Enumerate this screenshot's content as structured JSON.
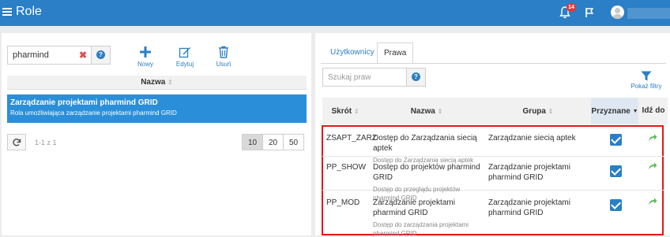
{
  "header": {
    "title": "Role",
    "notification_count": "14"
  },
  "left": {
    "search_value": "pharmind",
    "toolbar": {
      "new_label": "Nowy",
      "edit_label": "Edytuj",
      "delete_label": "Usuń"
    },
    "column_header": "Nazwa",
    "selected_role": {
      "name": "Zarządzanie projektami pharmind GRID",
      "description": "Rola umożliwiająca zarządzanie projektami pharmind GRID"
    },
    "page_info": "1-1 z 1",
    "page_sizes": [
      "10",
      "20",
      "50"
    ],
    "active_page_size": "10"
  },
  "right": {
    "tabs": {
      "users": "Użytkownicy",
      "rights": "Prawa"
    },
    "search_placeholder": "Szukaj praw",
    "show_filters": "Pokaż filtry",
    "columns": {
      "code": "Skrót",
      "name": "Nazwa",
      "group": "Grupa",
      "granted": "Przyznane",
      "goto": "Idź do"
    },
    "rows": [
      {
        "code": "ZSAPT_ZARZ",
        "name": "Dostęp do Zarządzania siecią aptek",
        "description": "Dostęp do Zarządzania siecią aptek",
        "group": "Zarządzanie siecią aptek",
        "granted": true
      },
      {
        "code": "PP_SHOW",
        "name": "Dostęp do projektów pharmind GRID",
        "description": "Dostęp do przeglądu projektów pharmind GRID",
        "group": "Zarządzanie projektami pharmind GRID",
        "granted": true
      },
      {
        "code": "PP_MOD",
        "name": "Zarządzanie projektami pharmind GRID",
        "description": "Dostęp do zarządzania projektami pharmind GRID",
        "group": "Zarządzanie projektami pharmind GRID",
        "granted": true
      }
    ]
  },
  "colors": {
    "primary": "#2a7fc6",
    "selected_row": "#2a8fd8",
    "highlight_border": "#e01818",
    "goto_arrow": "#5cb85c"
  }
}
